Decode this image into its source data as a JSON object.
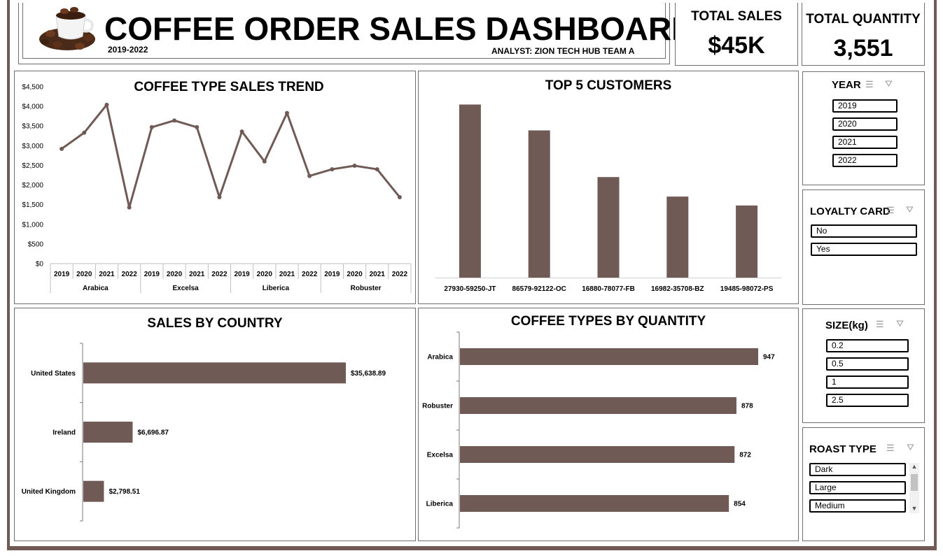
{
  "header": {
    "title": "COFFEE ORDER SALES DASHBOARD",
    "years": "2019-2022",
    "analyst": "ANALYST: ZION TECH HUB TEAM A"
  },
  "kpis": {
    "sales_label": "TOTAL SALES",
    "sales_value": "$45K",
    "qty_label": "TOTAL QUANTITY",
    "qty_value": "3,551"
  },
  "slicers": {
    "year": {
      "title": "YEAR",
      "items": [
        "2019",
        "2020",
        "2021",
        "2022"
      ]
    },
    "loyalty": {
      "title": "LOYALTY CARD",
      "items": [
        "No",
        "Yes"
      ]
    },
    "size": {
      "title": "SIZE(kg)",
      "items": [
        "0.2",
        "0.5",
        "1",
        "2.5"
      ]
    },
    "roast": {
      "title": "ROAST TYPE",
      "items": [
        "Dark",
        "Large",
        "Medium"
      ]
    }
  },
  "chart_data": [
    {
      "type": "line",
      "title": "COFFEE TYPE SALES TREND",
      "groups": [
        "Arabica",
        "Excelsa",
        "Liberica",
        "Robuster"
      ],
      "years": [
        "2019",
        "2020",
        "2021",
        "2022"
      ],
      "values": [
        2920,
        3330,
        4040,
        1430,
        3470,
        3640,
        3470,
        1690,
        3360,
        2600,
        3830,
        2230,
        2400,
        2490,
        2400,
        1690
      ],
      "ylim": [
        0,
        4500
      ],
      "yticks": [
        "$0",
        "$500",
        "$1,000",
        "$1,500",
        "$2,000",
        "$2,500",
        "$3,000",
        "$3,500",
        "$4,000",
        "$4,500"
      ],
      "color": "#705a55"
    },
    {
      "type": "bar",
      "title": "TOP 5 CUSTOMERS",
      "categories": [
        "27930-59250-JT",
        "86579-92122-OC",
        "16880-78077-FB",
        "16982-35708-BZ",
        "19485-98072-PS"
      ],
      "values": [
        4080,
        3470,
        2370,
        1910,
        1700
      ],
      "ylim": [
        0,
        4500
      ],
      "color": "#705a55"
    },
    {
      "type": "bar",
      "orientation": "horizontal",
      "title": "SALES BY COUNTRY",
      "categories": [
        "United States",
        "Ireland",
        "United Kingdom"
      ],
      "values": [
        35638.89,
        6696.87,
        2798.51
      ],
      "labels": [
        "$35,638.89",
        "$6,696.87",
        "$2,798.51"
      ],
      "color": "#705a55"
    },
    {
      "type": "bar",
      "orientation": "horizontal",
      "title": "COFFEE TYPES BY QUANTITY",
      "categories": [
        "Arabica",
        "Robuster",
        "Excelsa",
        "Liberica"
      ],
      "values": [
        947,
        878,
        872,
        854
      ],
      "labels": [
        "947",
        "878",
        "872",
        "854"
      ],
      "color": "#705a55"
    }
  ]
}
